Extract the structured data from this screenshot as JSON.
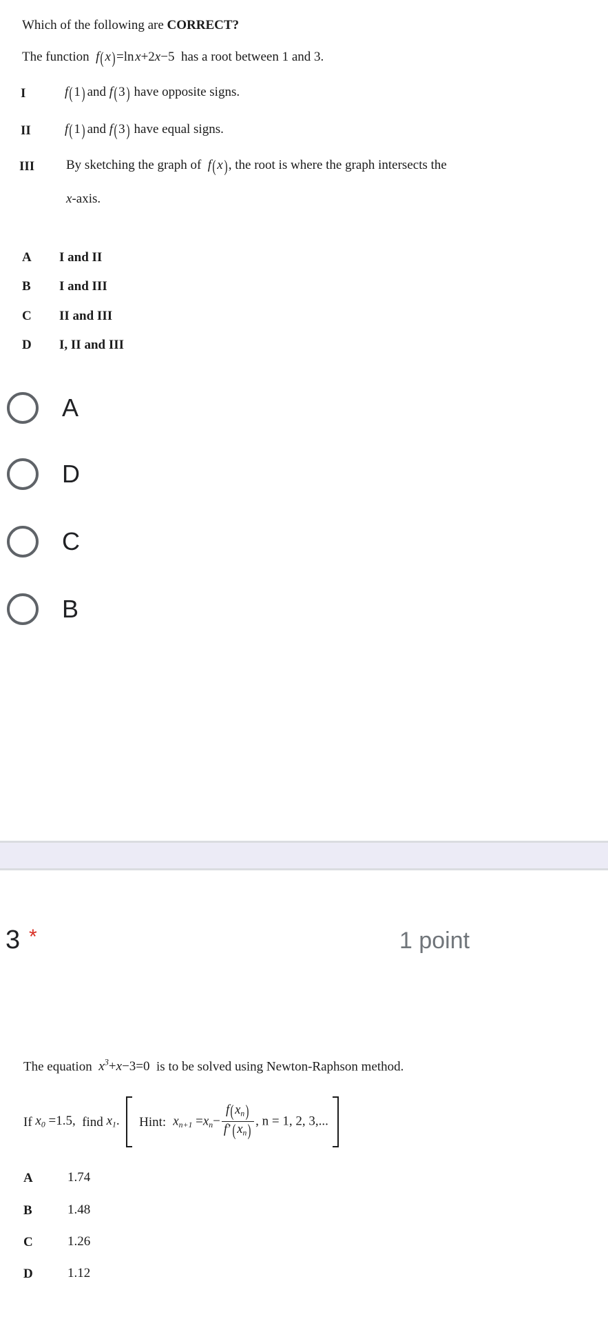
{
  "question2": {
    "prompt": "Which of the following are CORRECT?",
    "prompt_plain": "Which of the following are",
    "prompt_bold": "CORRECT?",
    "statement_prefix": "The function",
    "statement_fn": "f(x) = ln x + 2x - 5",
    "statement_suffix": "has a root between 1 and 3.",
    "roman_items": [
      {
        "numeral": "I",
        "text_a": "f(1)",
        "text_b": "and",
        "text_c": "f(3)",
        "text_d": "have opposite signs."
      },
      {
        "numeral": "II",
        "text_a": "f(1)",
        "text_b": "and",
        "text_c": "f(3)",
        "text_d": "have equal signs."
      },
      {
        "numeral": "III",
        "text_a": "By sketching the graph of",
        "text_b": "f(x)",
        "text_c": ", the root is where the graph intersects the",
        "text_d": "x-axis."
      }
    ],
    "choices": [
      {
        "letter": "A",
        "text": "I and II"
      },
      {
        "letter": "B",
        "text": "I and III"
      },
      {
        "letter": "C",
        "text": "II and III"
      },
      {
        "letter": "D",
        "text": "I, II and III"
      }
    ],
    "radio_options": [
      {
        "label": "A",
        "selected": false
      },
      {
        "label": "D",
        "selected": false
      },
      {
        "label": "C",
        "selected": false
      },
      {
        "label": "B",
        "selected": false
      }
    ]
  },
  "question3": {
    "number": "3",
    "required_marker": "*",
    "points": "1 point",
    "statement_prefix": "The equation",
    "statement_eq": "x³ + x - 3 = 0",
    "statement_suffix": "is to be solved using Newton-Raphson method.",
    "find_prefix": "If",
    "find_x0": "x₀ = 1.5,",
    "find_mid": "find",
    "find_x1": "x₁.",
    "hint_label": "Hint:",
    "hint_formula": "x(n+1) = x(n) - f(x(n))/f'(x(n)), n = 1, 2, 3, ...",
    "hint_tail": ", n = 1, 2, 3,...",
    "choices": [
      {
        "letter": "A",
        "value": "1.74"
      },
      {
        "letter": "B",
        "value": "1.48"
      },
      {
        "letter": "C",
        "value": "1.26"
      },
      {
        "letter": "D",
        "value": "1.12"
      }
    ]
  },
  "colors": {
    "text": "#1b1b1b",
    "required_red": "#d93025",
    "points_gray": "#70757a",
    "radio_border": "#5f6368",
    "band_fill": "#ecebf6",
    "band_border": "#dadce0"
  }
}
